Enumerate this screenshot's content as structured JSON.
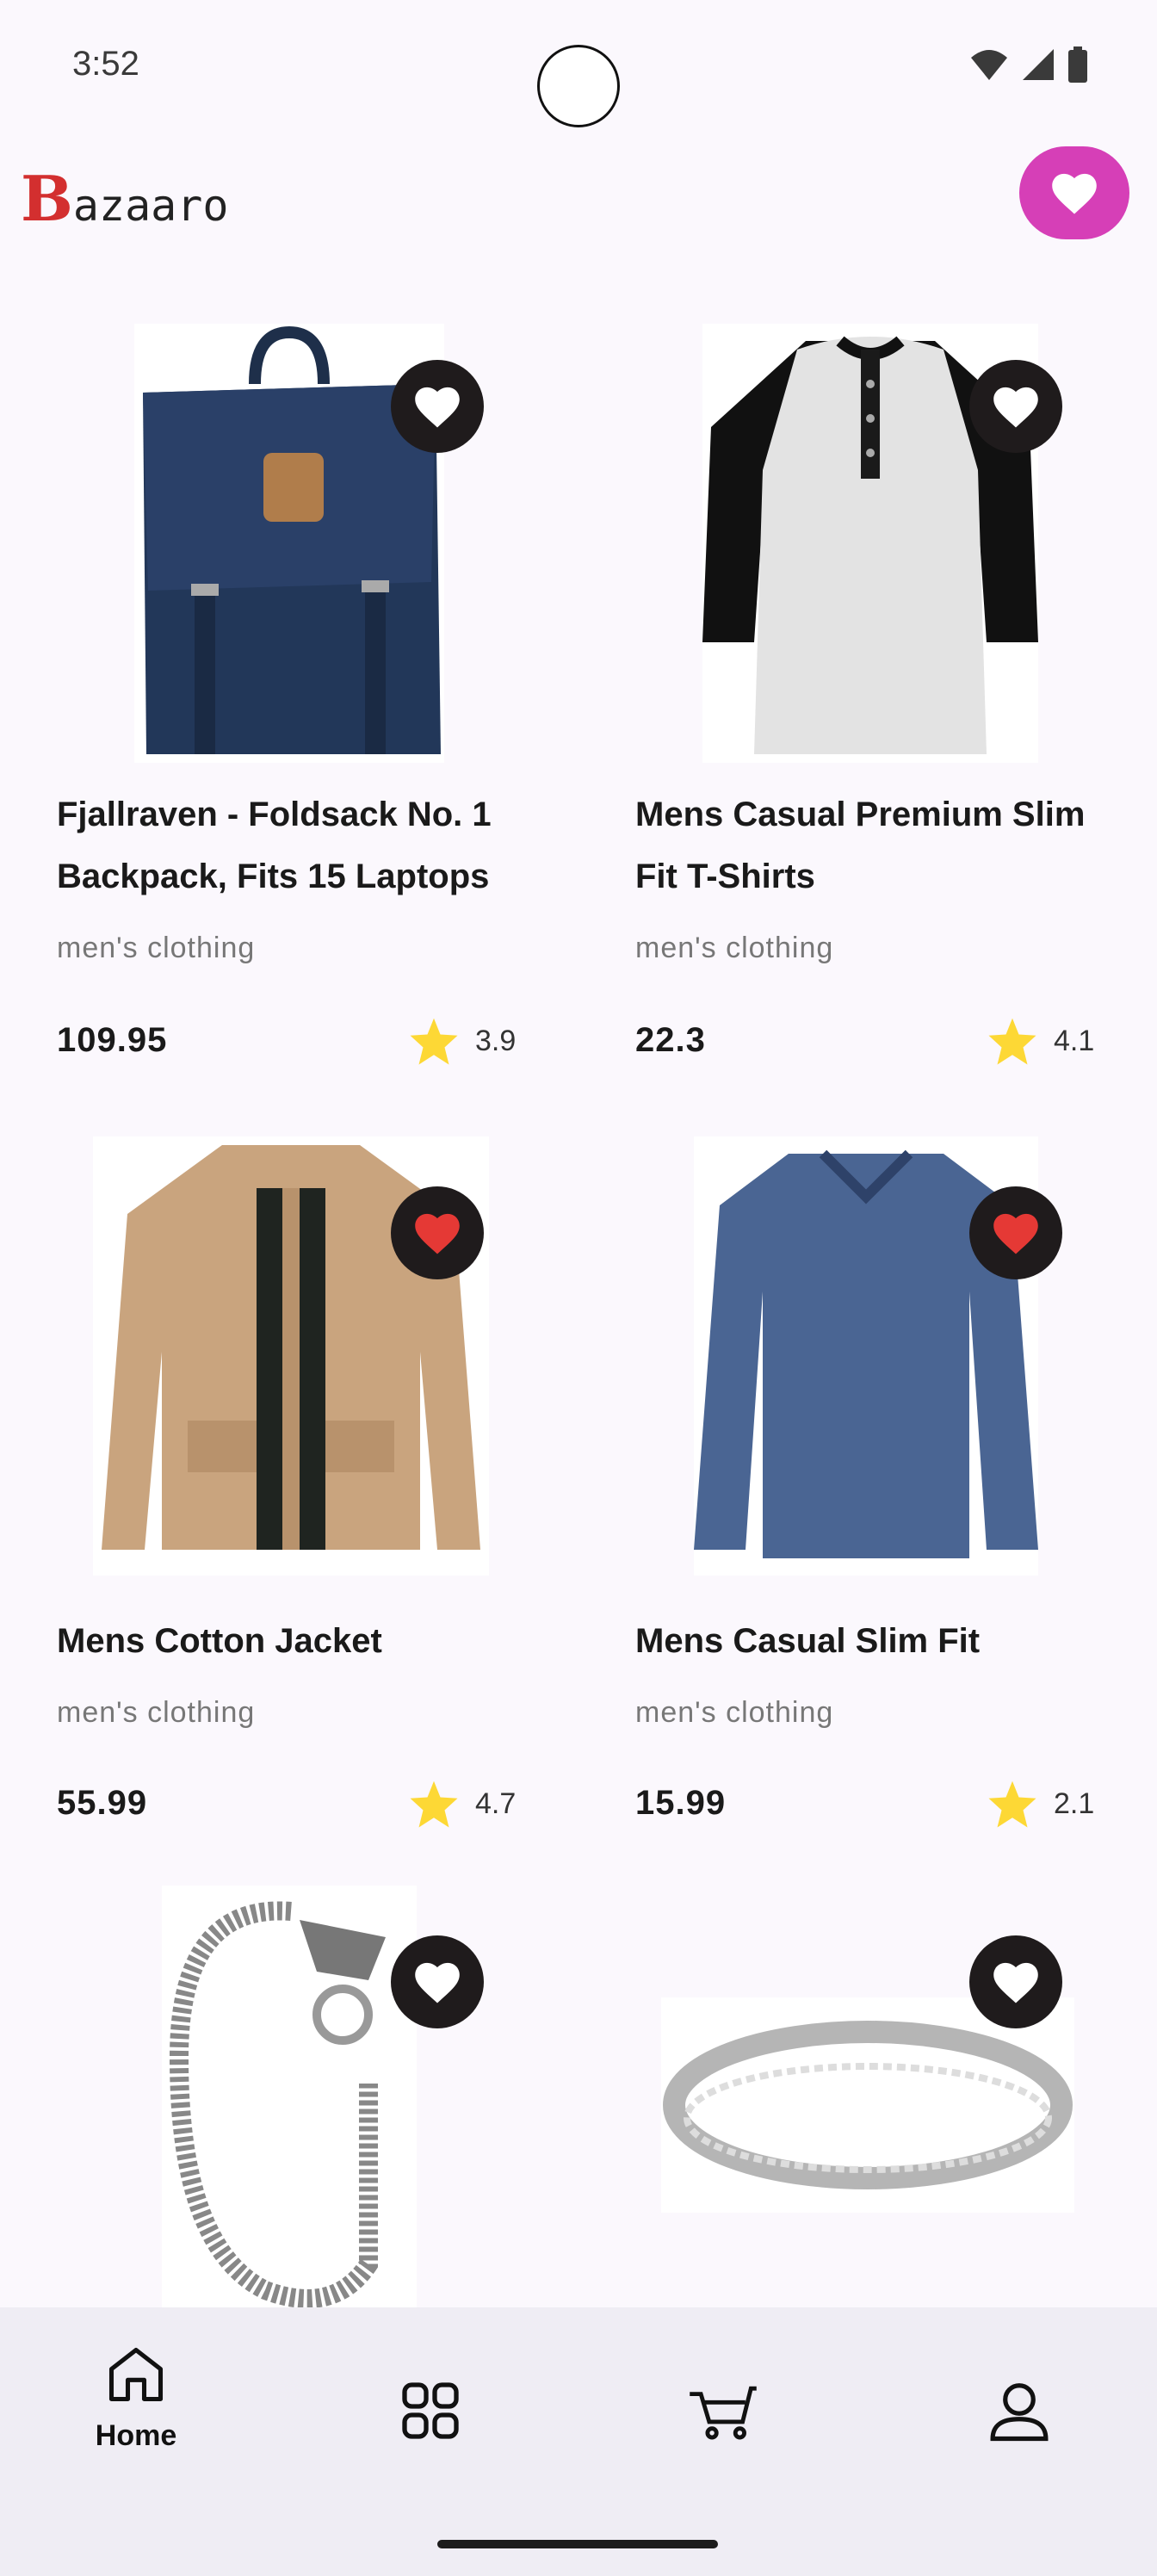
{
  "status_bar": {
    "time": "3:52"
  },
  "app_bar": {
    "logo_initial": "B",
    "logo_rest": "azaaro"
  },
  "products": [
    {
      "title": "Fjallraven - Foldsack No. 1 Backpack, Fits 15 Laptops",
      "category": "men's clothing",
      "price": "109.95",
      "rating": "3.9",
      "favorited": false,
      "image_icon": "backpack-image"
    },
    {
      "title": "Mens Casual Premium Slim Fit T-Shirts",
      "category": "men's clothing",
      "price": "22.3",
      "rating": "4.1",
      "favorited": false,
      "image_icon": "raglan-tshirt-image"
    },
    {
      "title": "Mens Cotton Jacket",
      "category": "men's clothing",
      "price": "55.99",
      "rating": "4.7",
      "favorited": true,
      "image_icon": "jacket-image"
    },
    {
      "title": "Mens Casual Slim Fit",
      "category": "men's clothing",
      "price": "15.99",
      "rating": "2.1",
      "favorited": true,
      "image_icon": "longsleeve-shirt-image"
    },
    {
      "favorited": false,
      "image_icon": "bracelet-image"
    },
    {
      "favorited": false,
      "image_icon": "ring-image"
    }
  ],
  "bottom_nav": {
    "items": [
      {
        "label": "Home",
        "icon": "home-icon"
      },
      {
        "icon": "categories-icon"
      },
      {
        "icon": "cart-icon"
      },
      {
        "icon": "profile-icon"
      }
    ]
  },
  "colors": {
    "accent": "#d63fb7",
    "favorite_active": "#e53935",
    "star": "#fdd835",
    "logo_initial": "#d32f2f"
  }
}
